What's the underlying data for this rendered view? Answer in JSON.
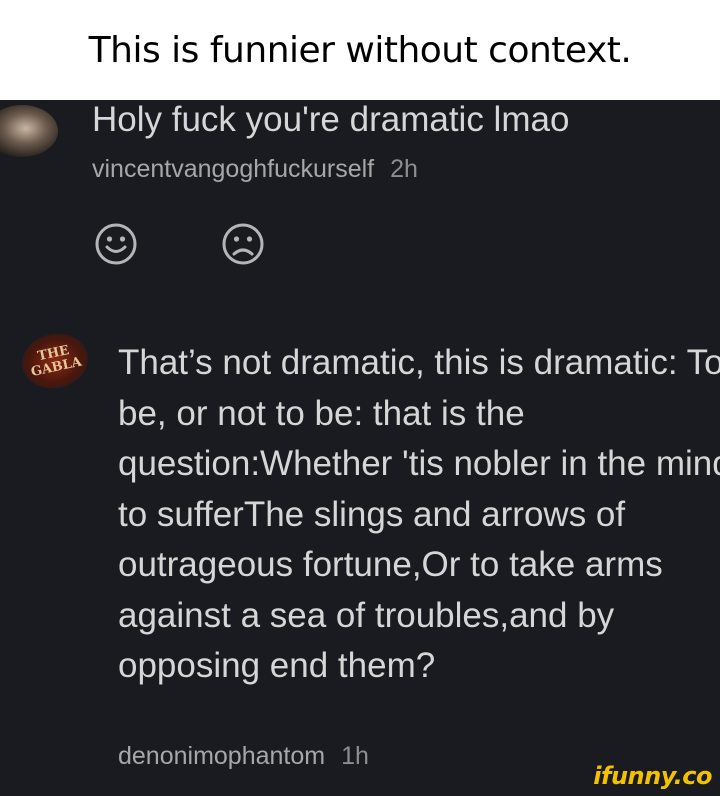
{
  "caption": "This is funnier without context.",
  "comment1": {
    "text": "Holy fuck you're dramatic lmao",
    "username": "vincentvangoghfuckurself",
    "time": "2h",
    "reactions": {
      "like_icon": "smiley-face-icon",
      "dislike_icon": "sad-face-icon"
    }
  },
  "comment2": {
    "avatar_text": [
      "THE",
      "GABLA"
    ],
    "text": "That’s not dramatic, this is dramatic: To be, or not to be: that is the question:Whether 'tis nobler in the mind to sufferThe slings and arrows of outrageous fortune,Or to take arms against a sea of troubles,and by opposing end them?",
    "username": "denonimophantom",
    "time": "1h"
  },
  "watermark": "ifunny.co",
  "colors": {
    "background": "#1a1b20",
    "text": "#d6d6d6",
    "meta": "#a7a7a9",
    "watermark": "#f2c200"
  }
}
